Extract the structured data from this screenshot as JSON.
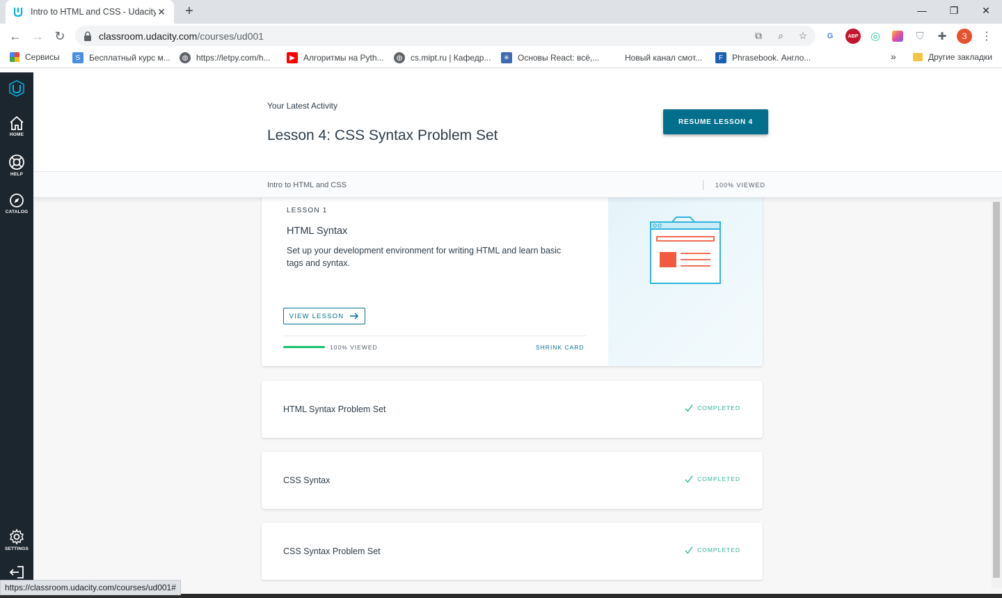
{
  "browser": {
    "tab_title": "Intro to HTML and CSS - Udacity",
    "url_host": "classroom.udacity.com",
    "url_path": "/courses/ud001",
    "profile_initial": "З",
    "status_url": "https://classroom.udacity.com/courses/ud001#"
  },
  "bookmarks": {
    "items": [
      {
        "label": "Сервисы"
      },
      {
        "label": "Бесплатный курс м..."
      },
      {
        "label": "https://letpy.com/h..."
      },
      {
        "label": "Алгоритмы на Pyth..."
      },
      {
        "label": "cs.mipt.ru | Кафедр..."
      },
      {
        "label": "Основы React: всё,..."
      },
      {
        "label": "Новый канал смот..."
      },
      {
        "label": "Phrasebook. Англо..."
      }
    ],
    "other": "Другие закладки",
    "overflow": "»"
  },
  "sidebar": {
    "home": "HOME",
    "help": "HELP",
    "catalog": "CATALOG",
    "settings": "SETTINGS"
  },
  "hero": {
    "eyebrow": "Your Latest Activity",
    "title": "Lesson 4: CSS Syntax Problem Set",
    "resume_label": "RESUME LESSON 4"
  },
  "course_bar": {
    "course_name": "Intro to HTML and CSS",
    "viewed": "100% VIEWED"
  },
  "lesson_card": {
    "number": "LESSON 1",
    "name": "HTML Syntax",
    "description": "Set up your development environment for writing HTML and learn basic tags and syntax.",
    "view_label": "VIEW LESSON",
    "progress": 1.0,
    "viewed": "100% VIEWED",
    "shrink": "SHRINK CARD"
  },
  "lessons": [
    {
      "name": "HTML Syntax Problem Set",
      "status": "COMPLETED"
    },
    {
      "name": "CSS Syntax",
      "status": "COMPLETED"
    },
    {
      "name": "CSS Syntax Problem Set",
      "status": "COMPLETED"
    }
  ],
  "colors": {
    "brand": "#02708d",
    "sidebar": "#1c262f",
    "success": "#2fb596",
    "illustration_accent": "#f15a3e",
    "illustration_frame": "#2eb4dc"
  }
}
